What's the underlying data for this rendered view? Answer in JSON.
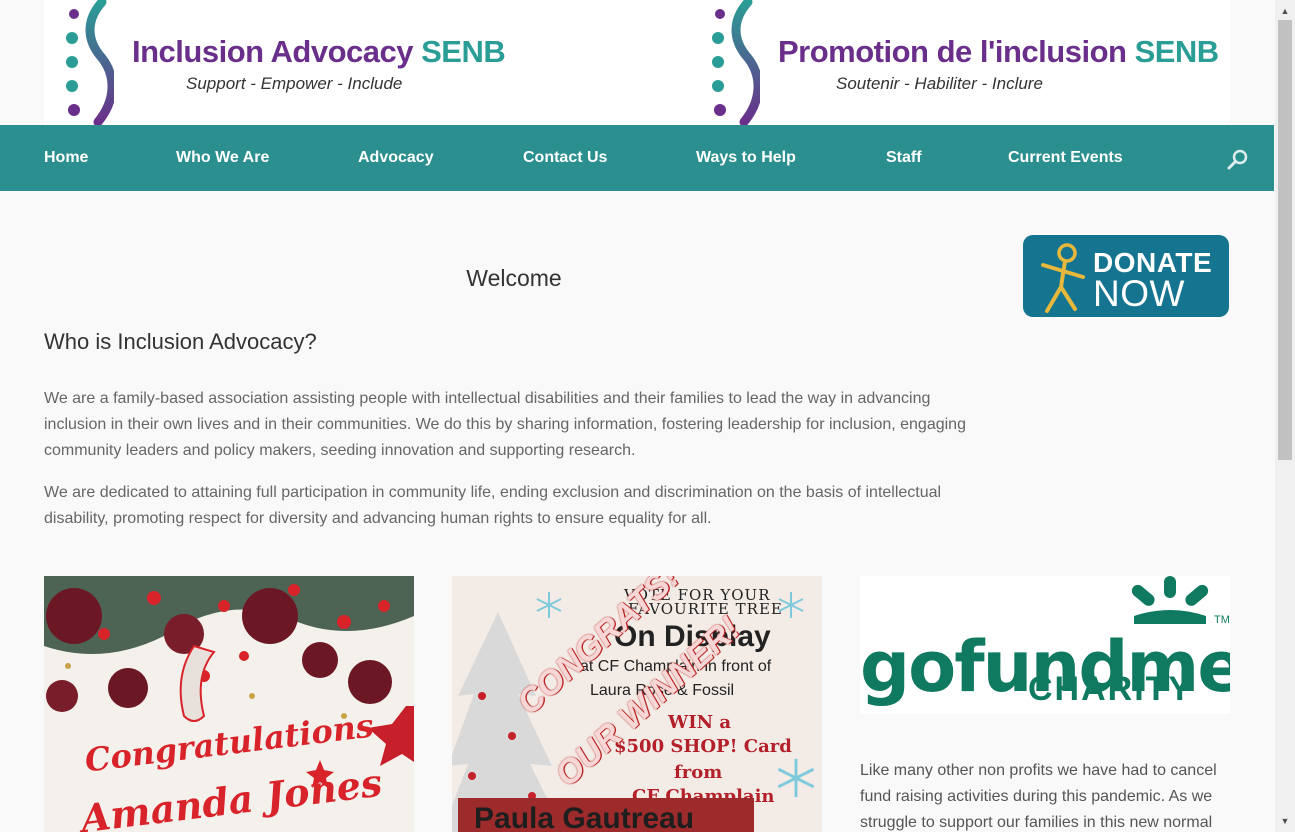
{
  "header": {
    "logo_en": {
      "title": "Inclusion Advocacy",
      "senb": "SENB",
      "tagline": "Support - Empower - Include"
    },
    "logo_fr": {
      "title": "Promotion de l'inclusion",
      "senb": "SENB",
      "tagline": "Soutenir - Habiliter - Inclure"
    }
  },
  "nav": {
    "items": [
      {
        "label": "Home"
      },
      {
        "label": "Who We Are"
      },
      {
        "label": "Advocacy"
      },
      {
        "label": "Contact Us"
      },
      {
        "label": "Ways to Help"
      },
      {
        "label": "Staff"
      },
      {
        "label": "Current Events"
      }
    ],
    "search_icon": "search-icon"
  },
  "main": {
    "welcome": "Welcome",
    "heading": "Who is Inclusion Advocacy?",
    "para1": "We are a family-based association assisting people with intellectual disabilities and their families to lead the way in advancing inclusion in their own lives and in their communities.  We do this by sharing information, fostering leadership for inclusion, engaging community leaders and policy makers, seeding innovation and supporting research.",
    "para2": "We are dedicated to attaining full participation in community life, ending exclusion and discrimination on the basis of intellectual disability, promoting respect for diversity and advancing human rights to ensure equality for all."
  },
  "donate": {
    "line1": "DONATE",
    "line2": "NOW"
  },
  "tiles": {
    "tile1": {
      "congrats": "Congratulations",
      "name": "Amanda Jones"
    },
    "tile2": {
      "vote": "VOTE FOR YOUR",
      "favourite": "FAVOURITE TREE",
      "on_display": "On Display",
      "at_cf": "at CF Champlain in front of",
      "store": "Laura Rose & Fossil",
      "win": "WIN a",
      "prize": "$500 SHOP! Card",
      "from": "from",
      "cf": "CF Champlain",
      "stamp1": "CONGRATS!",
      "stamp2": "OUR WINNER!",
      "winner": "Paula Gautreau"
    },
    "tile3": {
      "brand": "gofundme",
      "charity": "CHARITY",
      "tm": "TM"
    }
  },
  "side_text": "Like many other non profits we have had to cancel fund raising activities during this pandemic.  As we struggle to support our families in this new normal",
  "colors": {
    "nav": "#2a8f8e",
    "purple": "#6a2f8a",
    "teal": "#2a9d96",
    "donate": "#15748f",
    "gofundme": "#0f7a5f"
  }
}
